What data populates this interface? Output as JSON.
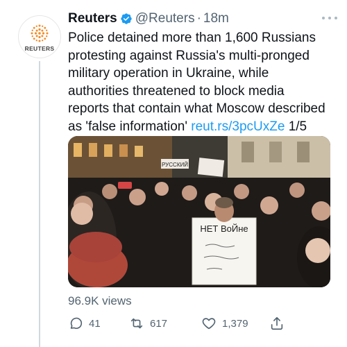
{
  "tweet": {
    "author_name": "Reuters",
    "handle": "@Reuters",
    "separator": "·",
    "time": "18m",
    "avatar_label": "REUTERS",
    "text_lines": [
      "Police detained more than 1,600 Russians",
      "protesting against Russia's multi-pronged",
      "military operation in Ukraine, while",
      "authorities threatened to block media",
      "reports that contain what Moscow described"
    ],
    "last_line_prefix": "as 'false information' ",
    "link_text": "reut.rs/3pcUxZe",
    "thread_counter": " 1/5",
    "views": "96.9K views",
    "replies": "41",
    "retweets": "617",
    "likes": "1,379"
  },
  "media": {
    "sign_main_line1": "НЕТ ВоЙне",
    "sign_small": "РУССКИЙ"
  },
  "colors": {
    "link": "#1d9bf0",
    "secondary_text": "#536471",
    "verified": "#1d9bf0",
    "reuters_orange": "#f28c28"
  },
  "icons": [
    "verified-badge-icon",
    "more-dots-icon",
    "reply-icon",
    "retweet-icon",
    "like-icon",
    "share-icon",
    "reuters-logo-icon"
  ]
}
